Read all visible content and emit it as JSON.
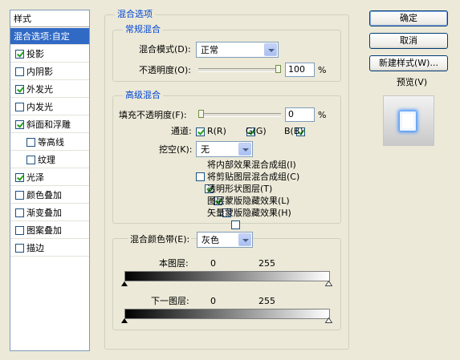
{
  "styles": {
    "header": "样式",
    "selected_item": "混合选项:自定",
    "items": [
      {
        "label": "投影",
        "checked": true,
        "indent": false
      },
      {
        "label": "内阴影",
        "checked": false,
        "indent": false
      },
      {
        "label": "外发光",
        "checked": true,
        "indent": false
      },
      {
        "label": "内发光",
        "checked": false,
        "indent": false
      },
      {
        "label": "斜面和浮雕",
        "checked": true,
        "indent": false
      },
      {
        "label": "等高线",
        "checked": false,
        "indent": true
      },
      {
        "label": "纹理",
        "checked": false,
        "indent": true
      },
      {
        "label": "光泽",
        "checked": true,
        "indent": false
      },
      {
        "label": "颜色叠加",
        "checked": false,
        "indent": false
      },
      {
        "label": "渐变叠加",
        "checked": false,
        "indent": false
      },
      {
        "label": "图案叠加",
        "checked": false,
        "indent": false
      },
      {
        "label": "描边",
        "checked": false,
        "indent": false
      }
    ]
  },
  "blend_options": {
    "title": "混合选项",
    "general": {
      "title": "常规混合",
      "mode_label": "混合模式(D):",
      "mode_value": "正常",
      "opacity_label": "不透明度(O):",
      "opacity_value": "100",
      "opacity_unit": "%",
      "opacity_fraction": 1.0
    },
    "advanced": {
      "title": "高级混合",
      "fill_label": "填充不透明度(F):",
      "fill_value": "0",
      "fill_unit": "%",
      "fill_fraction": 0.0,
      "channels_label": "通道:",
      "channel_r": "R(R)",
      "channel_g": "G(G)",
      "channel_b": "B(B)",
      "knockout_label": "挖空(K):",
      "knockout_value": "无",
      "options": [
        {
          "label": "将内部效果混合成组(I)",
          "checked": false
        },
        {
          "label": "将剪贴图层混合成组(C)",
          "checked": true
        },
        {
          "label": "透明形状图层(T)",
          "checked": true
        },
        {
          "label": "图层蒙版隐藏效果(L)",
          "checked": false
        },
        {
          "label": "矢量蒙版隐藏效果(H)",
          "checked": false
        }
      ]
    },
    "blend_if": {
      "label": "混合颜色带(E):",
      "value": "灰色",
      "this_layer_label": "本图层:",
      "this_layer_min": "0",
      "this_layer_max": "255",
      "underlying_label": "下一图层:",
      "underlying_min": "0",
      "underlying_max": "255"
    }
  },
  "buttons": {
    "ok": "确定",
    "cancel": "取消",
    "new_style": "新建样式(W)...",
    "preview_label": "预览(V)",
    "preview_checked": true
  }
}
